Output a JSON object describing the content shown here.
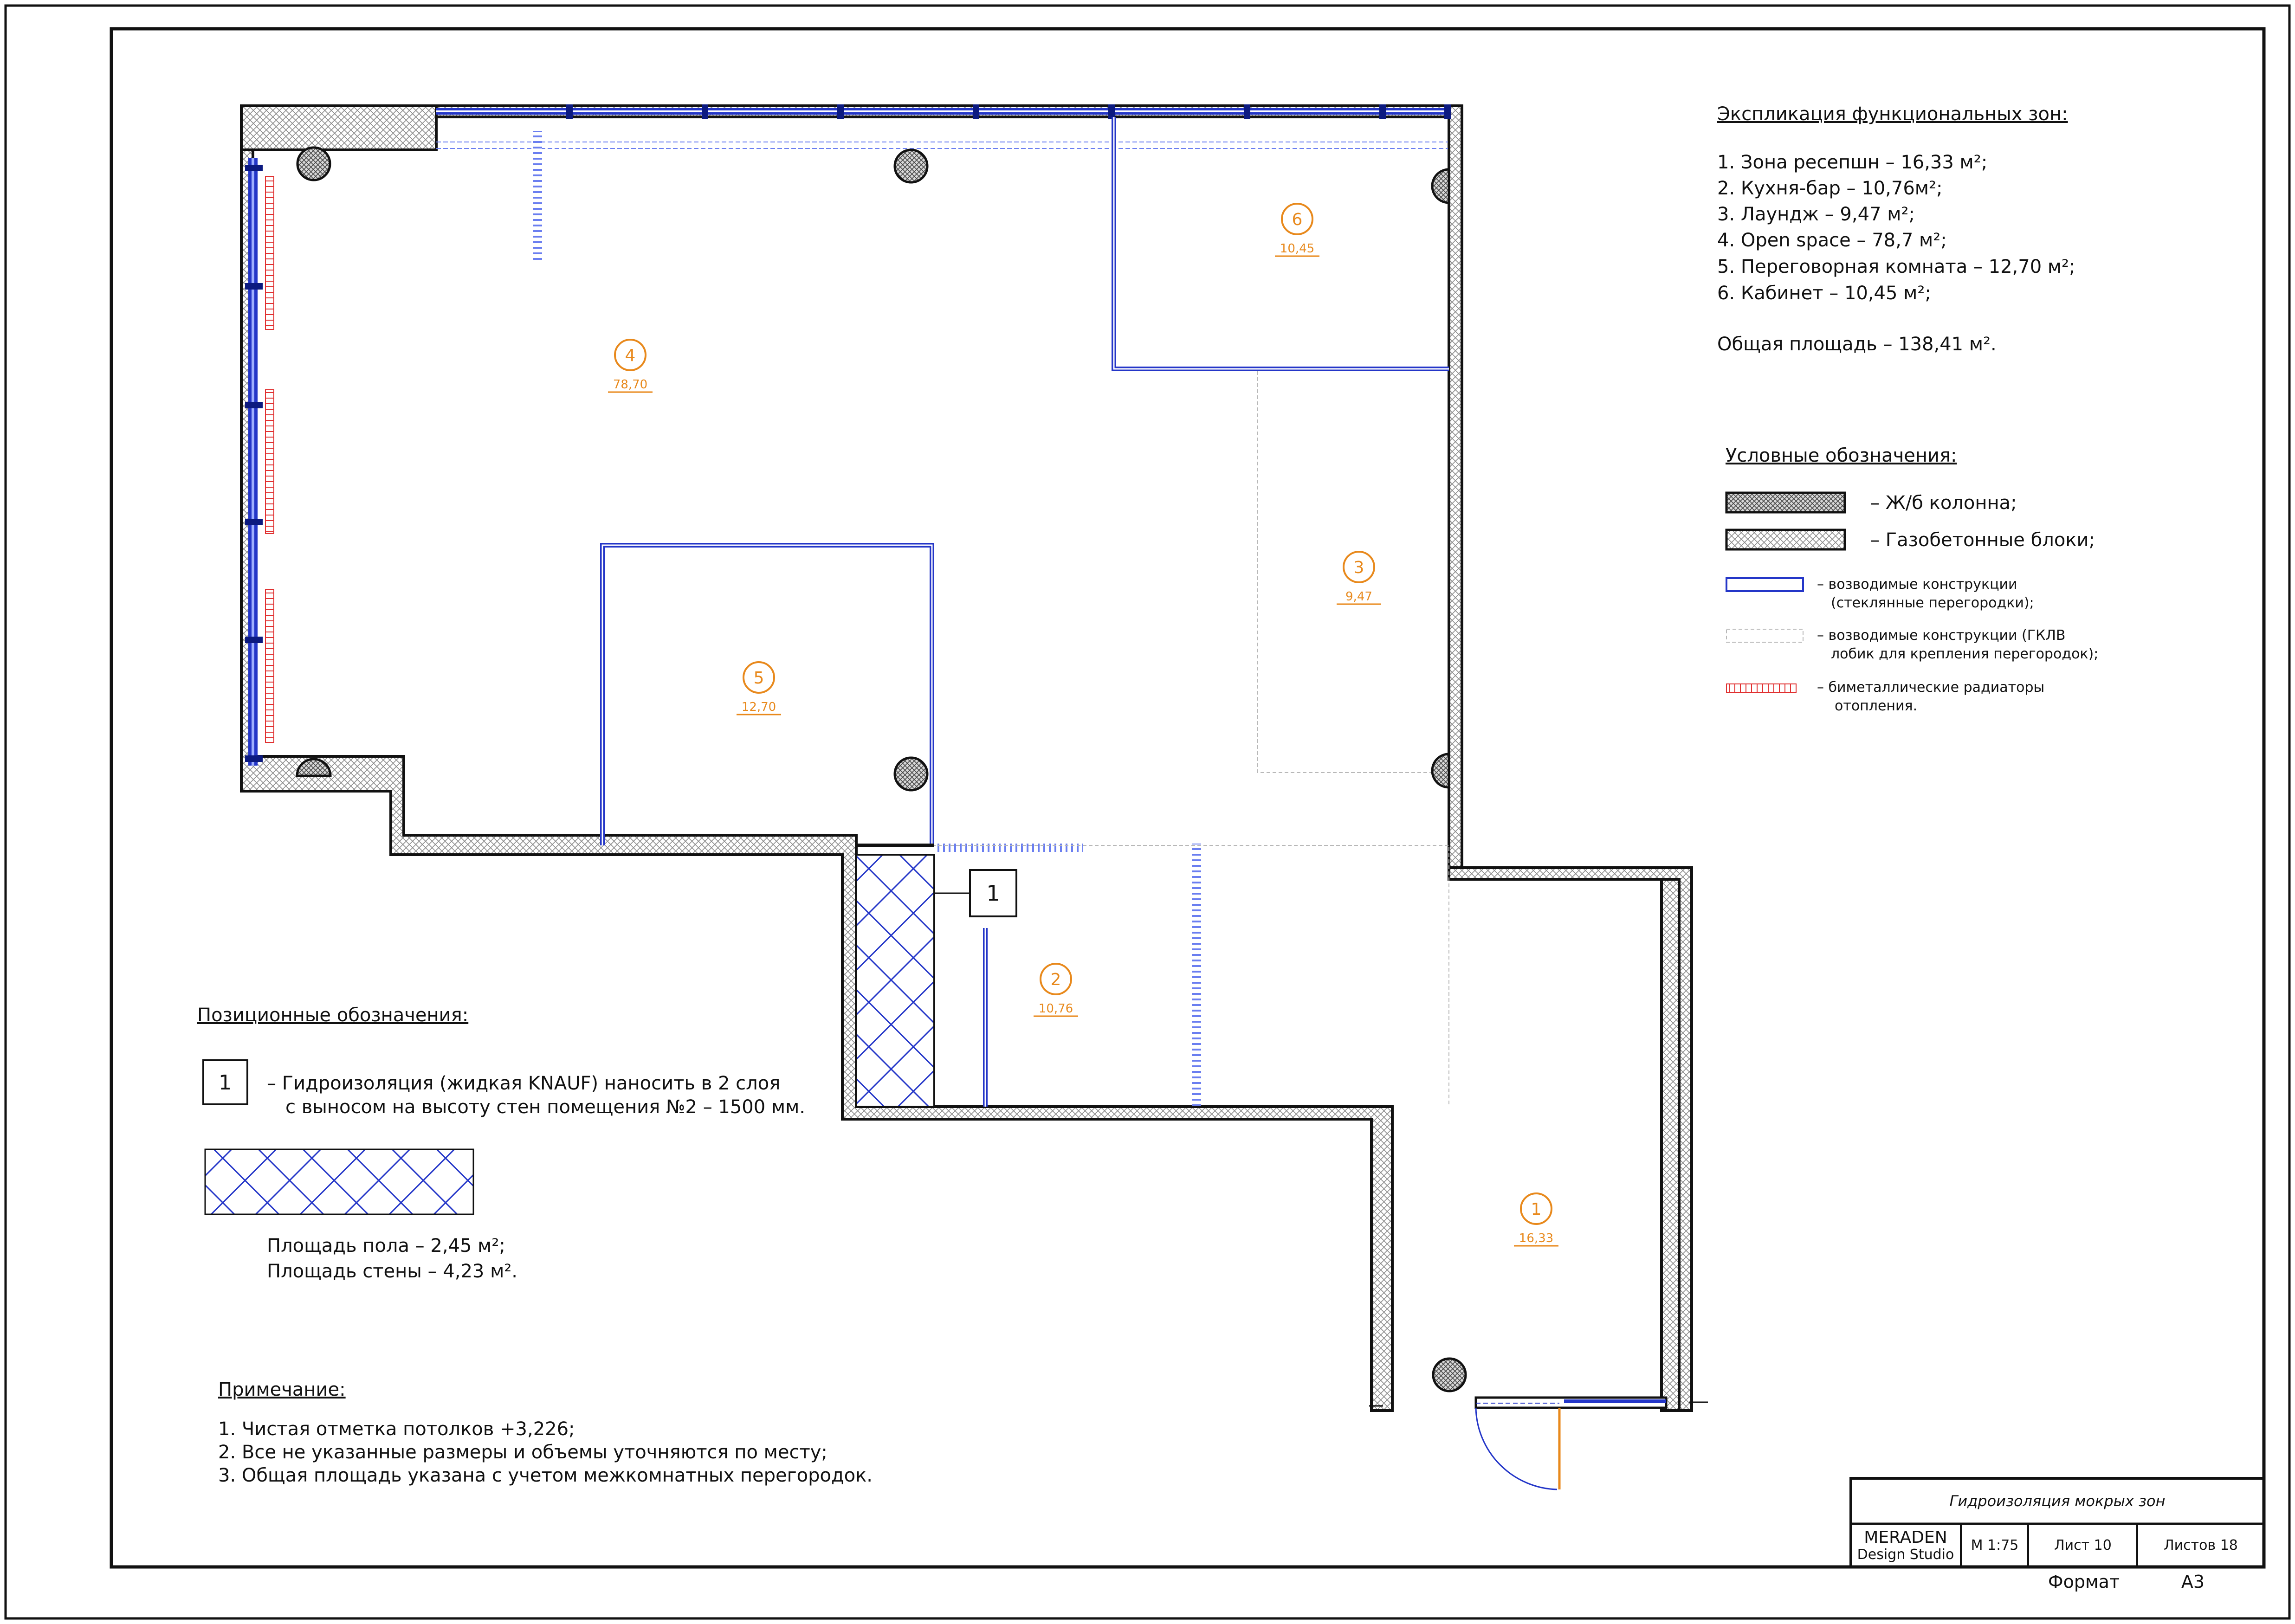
{
  "explication": {
    "title": "Экспликация функциональных зон:",
    "items": [
      "1. Зона ресепшн – 16,33 м²;",
      "2. Кухня-бар – 10,76м²;",
      "3. Лаундж – 9,47 м²;",
      "4. Open space – 78,7 м²;",
      "5. Переговорная комната – 12,70 м²;",
      "6. Кабинет – 10,45 м²;"
    ],
    "total": "Общая площадь – 138,41 м²."
  },
  "legend": {
    "title": "Условные обозначения:",
    "column": "– Ж/б колонна;",
    "gas_blocks": "– Газобетонные блоки;",
    "glass_line1": "– возводимые конструкции",
    "glass_line2": "(стеклянные перегородки);",
    "gkl_line1": "– возводимые конструкции (ГКЛВ",
    "gkl_line2": "лобик для крепления перегородок);",
    "radiator_line1": "– биметаллические радиаторы",
    "radiator_line2": "отопления."
  },
  "rooms": [
    {
      "num": "1",
      "area": "16,33"
    },
    {
      "num": "2",
      "area": "10,76"
    },
    {
      "num": "3",
      "area": "9,47"
    },
    {
      "num": "4",
      "area": "78,70"
    },
    {
      "num": "5",
      "area": "12,70"
    },
    {
      "num": "6",
      "area": "10,45"
    }
  ],
  "callout": "1",
  "positional": {
    "title": "Позиционные обозначения:",
    "marker": "1",
    "line1": "– Гидроизоляция (жидкая KNAUF) наносить в 2 слоя",
    "line2": "с выносом на высоту стен помещения №2 – 1500 мм.",
    "floor_area": "Площадь пола – 2,45 м²;",
    "wall_area": "Площадь стены – 4,23 м²."
  },
  "notes": {
    "title": "Примечание:",
    "items": [
      "1. Чистая отметка потолков +3,226;",
      "2. Все не указанные размеры и объемы уточняются по месту;",
      "3. Общая площадь указана с учетом межкомнатных перегородок."
    ]
  },
  "title_block": {
    "sheet_title": "Гидроизоляция мокрых зон",
    "company_line1": "MERADEN",
    "company_line2": "Design Studio",
    "scale": "М 1:75",
    "sheet": "Лист 10",
    "sheets": "Листов 18",
    "format_label": "Формат",
    "format_value": "А3"
  },
  "colors": {
    "wall_hatch": "#8a8a8a",
    "glass": "#3a4ed8",
    "room_tag": "#e8891c",
    "radiator": "#e03030",
    "gklv": "#b8b8b8",
    "waterproofing": "#2436c8"
  }
}
